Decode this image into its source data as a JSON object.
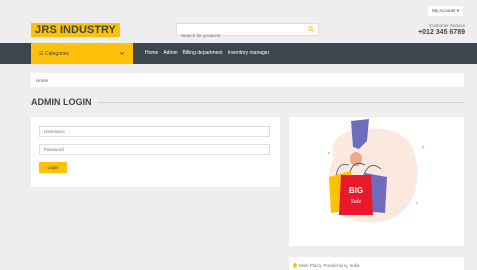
{
  "topbar": {
    "my_account": "My Account ▾"
  },
  "header": {
    "logo_part1": "JRS",
    "logo_part2": "INDUSTRY",
    "search_placeholder": "Search for products",
    "customer_service_label": "Customer Service",
    "customer_service_phone": "+012 345 6789"
  },
  "navbar": {
    "categories_label": "☰  Categories",
    "links": [
      "Home",
      "Admin",
      "Billing department",
      "Inventory manager"
    ]
  },
  "breadcrumb": {
    "home": "Home"
  },
  "login": {
    "title": "ADMIN LOGIN",
    "username_placeholder": "Username",
    "password_placeholder": "Password",
    "button_label": "Login"
  },
  "promo": {
    "badge_line1": "BIG",
    "badge_line2": "Sale"
  },
  "bottom": {
    "address_partial": "Multi Plaza, Pondicherry, India"
  },
  "colors": {
    "accent": "#FFC107",
    "dark": "#3d464d",
    "background": "#eeeeee"
  }
}
